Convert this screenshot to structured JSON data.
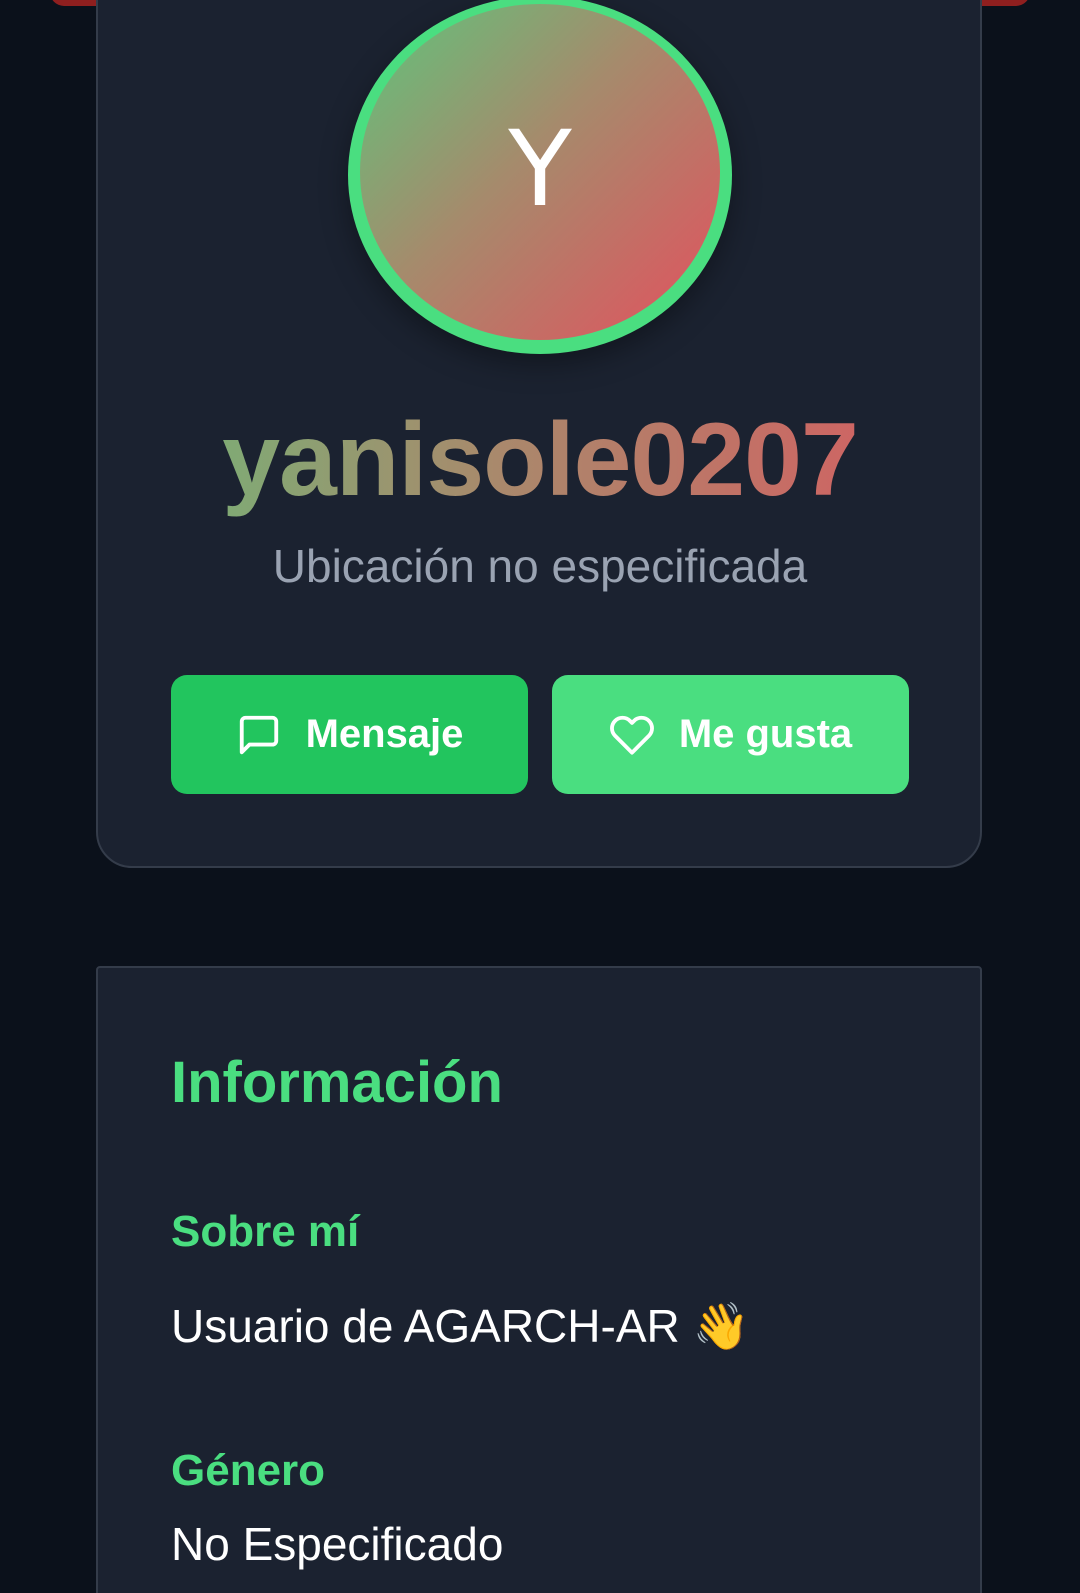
{
  "profile": {
    "avatar_initial": "Y",
    "username": "yanisole0207",
    "location": "Ubicación no especificada",
    "actions": {
      "message_label": "Mensaje",
      "like_label": "Me gusta"
    },
    "icons": [
      "message-square-icon",
      "heart-icon"
    ]
  },
  "info": {
    "title": "Información",
    "about_label": "Sobre mí",
    "about_text": "Usuario de AGARCH-AR",
    "about_emoji": "👋",
    "gender_label": "Género",
    "gender_value": "No Especificado"
  },
  "colors": {
    "background": "#0b111b",
    "card": "#1b2230",
    "accent_green": "#4ade80",
    "button_green": "#22c55e",
    "gradient_start": "#5ec57c",
    "gradient_end": "#e4505e",
    "top_strip": "#8f1f1f"
  }
}
